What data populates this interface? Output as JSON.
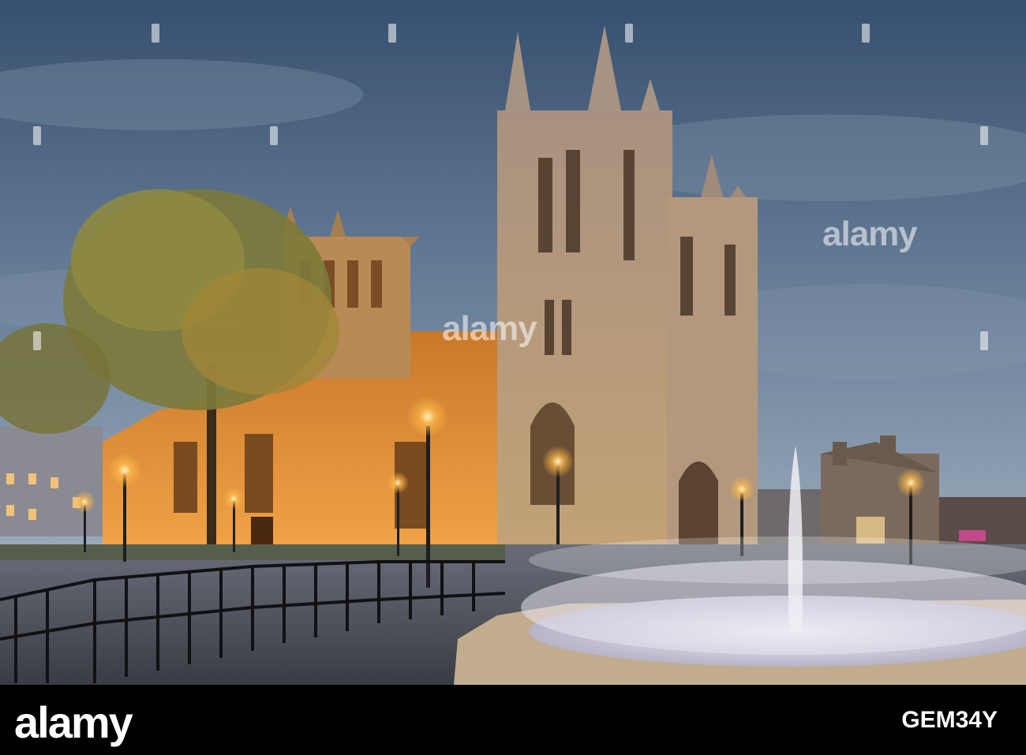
{
  "watermark": {
    "center_text": "alamy",
    "right_text": "alamy"
  },
  "footer": {
    "logo": "alamy",
    "image_id": "GEM34Y"
  },
  "colors": {
    "sky_top": "#3c5878",
    "sky_bottom": "#a9b6c4",
    "stone_lit": "#e8902e",
    "stone_tower": "#b9a088",
    "fountain_water": "#e6e3ee",
    "strip": "#000000"
  }
}
